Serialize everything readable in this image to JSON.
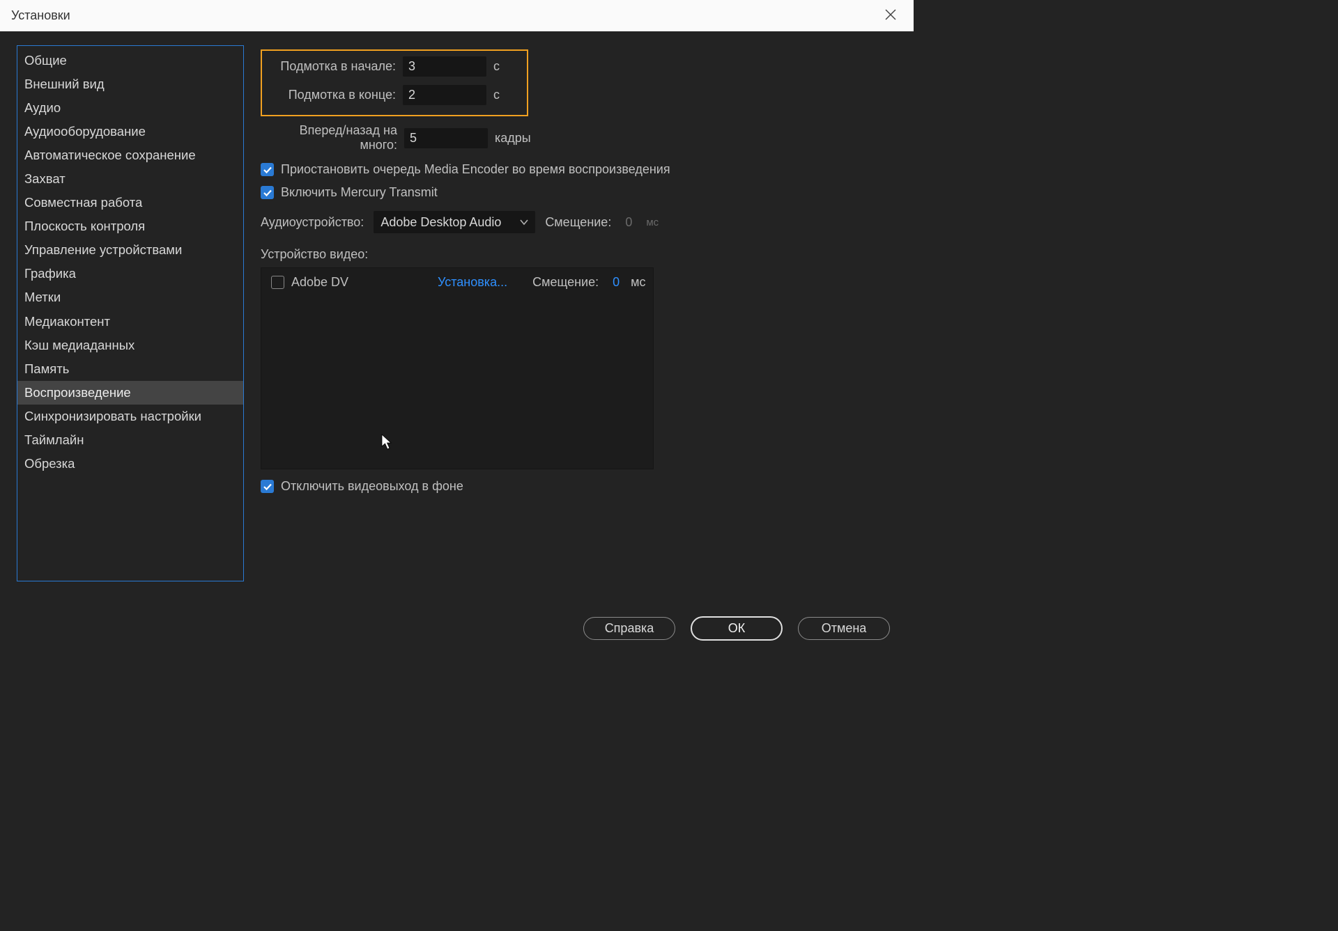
{
  "window": {
    "title": "Установки"
  },
  "sidebar": {
    "items": [
      {
        "label": "Общие"
      },
      {
        "label": "Внешний вид"
      },
      {
        "label": "Аудио"
      },
      {
        "label": "Аудиооборудование"
      },
      {
        "label": "Автоматическое сохранение"
      },
      {
        "label": "Захват"
      },
      {
        "label": "Совместная работа"
      },
      {
        "label": "Плоскость контроля"
      },
      {
        "label": "Управление устройствами"
      },
      {
        "label": "Графика"
      },
      {
        "label": "Метки"
      },
      {
        "label": "Медиаконтент"
      },
      {
        "label": "Кэш медиаданных"
      },
      {
        "label": "Память"
      },
      {
        "label": "Воспроизведение"
      },
      {
        "label": "Синхронизировать настройки"
      },
      {
        "label": "Таймлайн"
      },
      {
        "label": "Обрезка"
      }
    ],
    "selected_index": 14
  },
  "settings": {
    "preroll_label": "Подмотка в начале:",
    "preroll_value": "3",
    "preroll_unit": "с",
    "postroll_label": "Подмотка в конце:",
    "postroll_value": "2",
    "postroll_unit": "с",
    "step_label": "Вперед/назад на много:",
    "step_value": "5",
    "step_unit": "кадры",
    "pause_encoder_label": "Приостановить очередь Media Encoder во время воспроизведения",
    "mercury_label": "Включить Mercury Transmit",
    "audio_device_label": "Аудиоустройство:",
    "audio_device_value": "Adobe Desktop Audio",
    "audio_offset_label": "Смещение:",
    "audio_offset_value": "0",
    "audio_offset_unit": "мс",
    "video_device_label": "Устройство видео:",
    "device": {
      "name": "Adobe DV",
      "setup_link": "Установка...",
      "offset_label": "Смещение:",
      "offset_value": "0",
      "offset_unit": "мс"
    },
    "disable_output_label": "Отключить видеовыход в фоне"
  },
  "footer": {
    "help": "Справка",
    "ok": "ОК",
    "cancel": "Отмена"
  }
}
